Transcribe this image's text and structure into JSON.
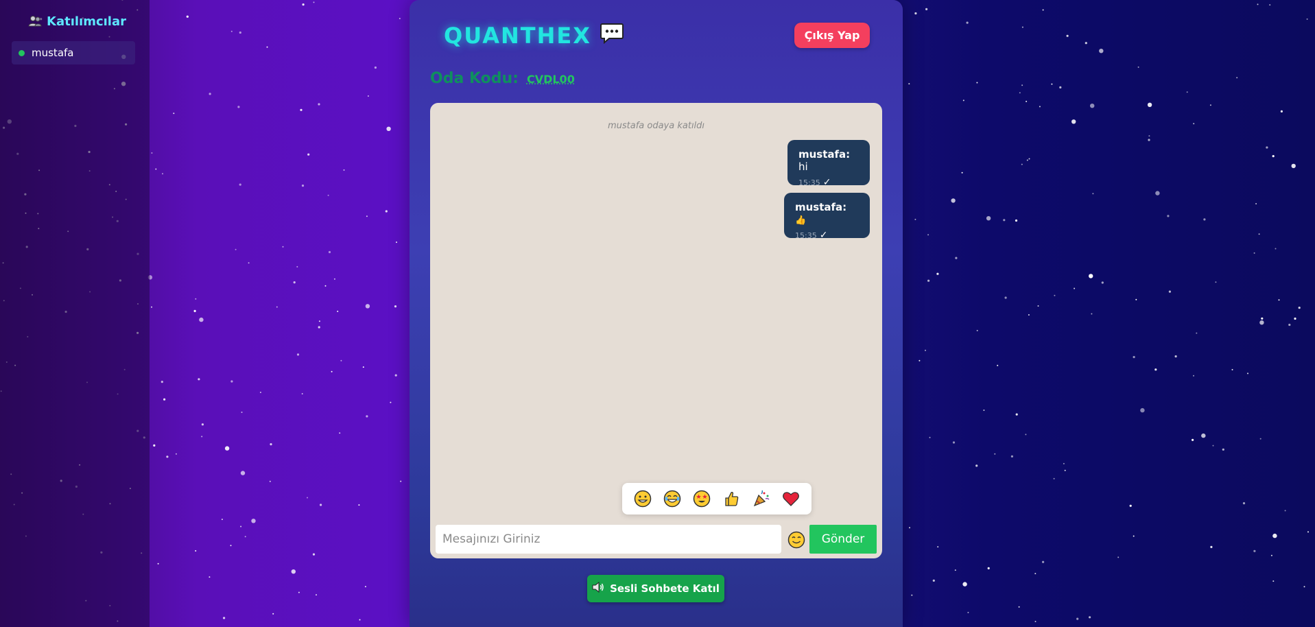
{
  "sidebar": {
    "title": "Katılımcılar",
    "title_icon": "users-icon",
    "participants": [
      {
        "name": "mustafa",
        "status": "online",
        "status_color": "#22c55e"
      }
    ]
  },
  "header": {
    "brand": "QUANTHEX",
    "brand_icon": "chat-bubble-icon",
    "logout_label": "Çıkış Yap"
  },
  "room": {
    "label": "Oda Kodu:",
    "code": "CVDL00"
  },
  "chat": {
    "system_message": "mustafa odaya katıldı",
    "messages": [
      {
        "sender": "mustafa:",
        "text": "hi",
        "time": "15:35",
        "status": "✓"
      },
      {
        "sender": "mustafa:",
        "text": "👍",
        "time": "15:35",
        "status": "✓"
      }
    ]
  },
  "emoji_picker": [
    "😀",
    "😂",
    "🤩",
    "👍",
    "🎉",
    "❤️"
  ],
  "composer": {
    "placeholder": "Mesajınızı Giriniz",
    "emoji_button": "😊",
    "send_label": "Gönder"
  },
  "voice": {
    "label": "Sesli Sohbete Katıl",
    "icon": "speaker-icon"
  },
  "colors": {
    "accent": "#22e5e0",
    "logout": "#f43f5e",
    "send": "#22c55e",
    "bubble": "#203a5a",
    "chat_bg": "#e5ddd5"
  }
}
